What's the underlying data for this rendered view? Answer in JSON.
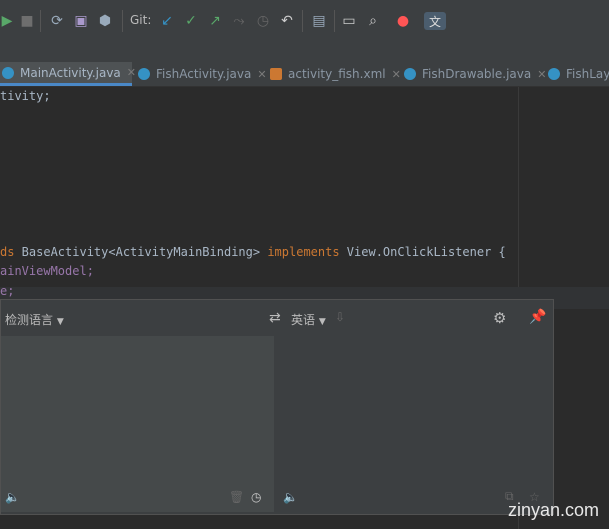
{
  "toolbar": {
    "git_label": "Git:",
    "icons": [
      "run-icon",
      "stop-icon",
      "sync-icon",
      "device-icon",
      "sdk-icon",
      "update-icon",
      "commit-icon",
      "push-icon",
      "revert-icon",
      "history-icon",
      "undo-icon",
      "project-icon",
      "terminal-icon",
      "search-icon",
      "plugin-icon",
      "translate-icon"
    ]
  },
  "tabs": [
    {
      "label": "MainActivity.java",
      "active": true
    },
    {
      "label": "FishActivity.java",
      "active": false
    },
    {
      "label": "activity_fish.xml",
      "active": false
    },
    {
      "label": "FishDrawable.java",
      "active": false
    },
    {
      "label": "FishLayo",
      "active": false
    }
  ],
  "editor": {
    "line1": "tivity;",
    "line2_kw1": "ds",
    "line2_mid": " BaseActivity<ActivityMainBinding> ",
    "line2_kw2": "implements",
    "line2_end": " View.OnClickListener {",
    "line3": "ainViewModel;",
    "line4": "e;"
  },
  "translator": {
    "source_lang": "检测语言",
    "target_lang": "英语",
    "swap_icon": "swap-icon",
    "settings_icon": "gear-icon",
    "pin_icon": "pin-icon"
  },
  "watermark": "zinyan.com"
}
